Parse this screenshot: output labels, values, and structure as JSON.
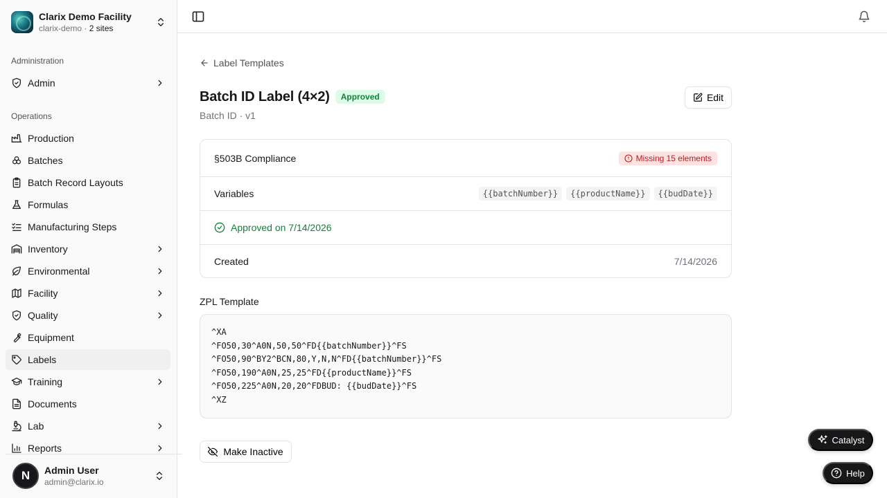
{
  "org": {
    "name": "Clarix Demo Facility",
    "slug": "clarix-demo",
    "separator": " · ",
    "sites": "2 sites"
  },
  "sidebar": {
    "admin_section": "Administration",
    "admin_items": [
      {
        "label": "Admin",
        "icon": "shield-check-icon",
        "has_children": true
      }
    ],
    "ops_section": "Operations",
    "ops_items": [
      {
        "label": "Production",
        "icon": "factory-icon",
        "has_children": false
      },
      {
        "label": "Batches",
        "icon": "boxes-icon",
        "has_children": false
      },
      {
        "label": "Batch Record Layouts",
        "icon": "clipboard-icon",
        "has_children": false
      },
      {
        "label": "Formulas",
        "icon": "flask-icon",
        "has_children": false
      },
      {
        "label": "Manufacturing Steps",
        "icon": "list-checks-icon",
        "has_children": false
      },
      {
        "label": "Inventory",
        "icon": "warehouse-icon",
        "has_children": true
      },
      {
        "label": "Environmental",
        "icon": "leaf-icon",
        "has_children": true
      },
      {
        "label": "Facility",
        "icon": "map-icon",
        "has_children": true
      },
      {
        "label": "Quality",
        "icon": "shield-check-icon",
        "has_children": true
      },
      {
        "label": "Equipment",
        "icon": "wrench-icon",
        "has_children": false
      },
      {
        "label": "Labels",
        "icon": "tag-icon",
        "has_children": false,
        "active": true
      },
      {
        "label": "Training",
        "icon": "graduation-cap-icon",
        "has_children": true
      },
      {
        "label": "Documents",
        "icon": "file-text-icon",
        "has_children": false
      },
      {
        "label": "Lab",
        "icon": "microscope-icon",
        "has_children": true
      },
      {
        "label": "Reports",
        "icon": "bar-chart-icon",
        "has_children": true
      }
    ]
  },
  "user": {
    "initial": "N",
    "name": "Admin User",
    "email": "admin@clarix.io"
  },
  "breadcrumb": {
    "back_label": "Label Templates"
  },
  "template": {
    "title": "Batch ID Label (4×2)",
    "status": "Approved",
    "subtitle": "Batch ID · v1",
    "edit_label": "Edit"
  },
  "details": {
    "compliance_label": "§503B Compliance",
    "compliance_status": "Missing 15 elements",
    "variables_label": "Variables",
    "variables": [
      "{{batchNumber}}",
      "{{productName}}",
      "{{budDate}}"
    ],
    "approved_text": "Approved on 7/14/2026",
    "created_label": "Created",
    "created_value": "7/14/2026"
  },
  "zpl": {
    "heading": "ZPL Template",
    "lines": [
      "^XA",
      "^FO50,30^A0N,50,50^FD{{batchNumber}}^FS",
      "^FO50,90^BY2^BCN,80,Y,N,N^FD{{batchNumber}}^FS",
      "^FO50,190^A0N,25,25^FD{{productName}}^FS",
      "^FO50,225^A0N,20,20^FDBUD: {{budDate}}^FS",
      "^XZ"
    ]
  },
  "actions": {
    "make_inactive_label": "Make Inactive"
  },
  "floating": {
    "catalyst_label": "Catalyst",
    "help_label": "Help"
  },
  "colors": {
    "approved_green": "#15803d",
    "approved_bg": "#dcfce7",
    "missing_red": "#b91c1c",
    "missing_bg": "#fee2e2",
    "dark_button": "#18181b"
  }
}
